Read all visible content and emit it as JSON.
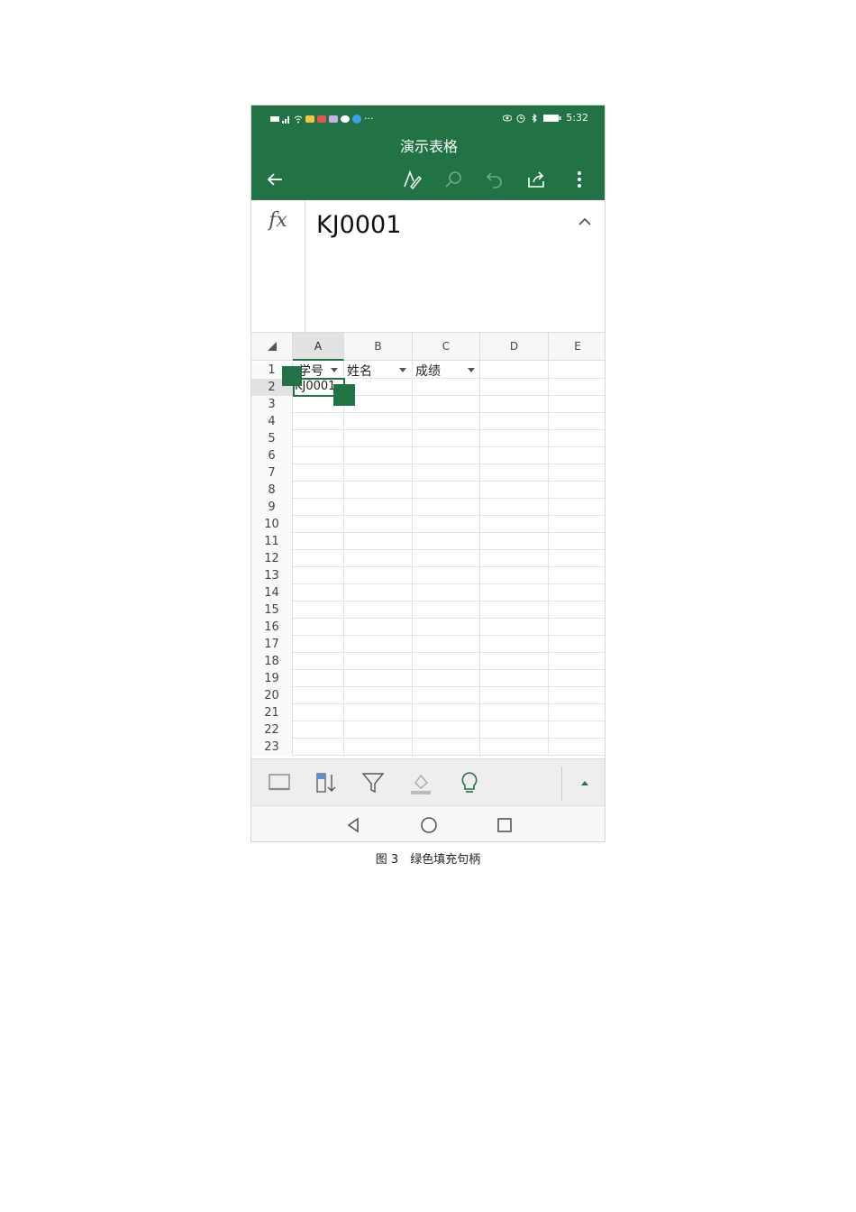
{
  "status_bar": {
    "time": "5:32",
    "more": "···"
  },
  "document": {
    "title": "演示表格"
  },
  "toolbar": {
    "back_icon": "arrow-left-icon",
    "icons": [
      "pen-draw-icon",
      "search-icon",
      "undo-icon",
      "share-icon",
      "more-vertical-icon"
    ]
  },
  "formula_bar": {
    "fx_label": "fx",
    "value": "KJ0001"
  },
  "sheet": {
    "columns": [
      "A",
      "B",
      "C",
      "D",
      "E"
    ],
    "rows": [
      "1",
      "2",
      "3",
      "4",
      "5",
      "6",
      "7",
      "8",
      "9",
      "10",
      "11",
      "12",
      "13",
      "14",
      "15",
      "16",
      "17",
      "18",
      "19",
      "20",
      "21",
      "22",
      "23"
    ],
    "cells": {
      "A1": "学号",
      "B1": "姓名",
      "C1": "成绩",
      "A2": "KJ0001"
    },
    "selected_cell": "A2"
  },
  "bottom_toolbar": {
    "icons": [
      "screen-icon",
      "sort-icon",
      "filter-icon",
      "fill-color-icon",
      "lightbulb-icon",
      "expand-up-icon"
    ]
  },
  "nav_bar": {
    "icons": [
      "back-triangle-icon",
      "home-circle-icon",
      "recents-square-icon"
    ]
  },
  "caption": "图 3　绿色填充句柄",
  "colors": {
    "accent": "#217346",
    "grid": "#e3e3e3"
  }
}
